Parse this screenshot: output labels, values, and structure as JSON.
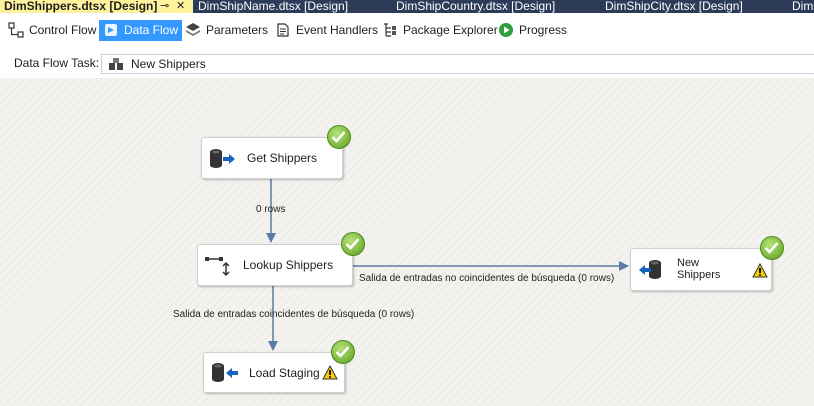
{
  "tabs": [
    {
      "label": "DimShippers.dtsx [Design]",
      "active": true,
      "pin": "⊸",
      "close": "✕"
    },
    {
      "label": "DimShipName.dtsx [Design]"
    },
    {
      "label": "DimShipCountry.dtsx [Design]"
    },
    {
      "label": "DimShipCity.dtsx [Design]"
    },
    {
      "label": "Dim"
    }
  ],
  "designer_tabs": [
    {
      "label": "Control Flow",
      "icon": "control-flow-icon"
    },
    {
      "label": "Data Flow",
      "icon": "data-flow-icon",
      "selected": true
    },
    {
      "label": "Parameters",
      "icon": "parameters-icon"
    },
    {
      "label": "Event Handlers",
      "icon": "event-handlers-icon"
    },
    {
      "label": "Package Explorer",
      "icon": "package-explorer-icon"
    },
    {
      "label": "Progress",
      "icon": "progress-icon"
    }
  ],
  "task": {
    "label": "Data Flow Task:",
    "value": "New Shippers"
  },
  "components": [
    {
      "name": "Get Shippers",
      "type": "source",
      "status": "success"
    },
    {
      "name": "Lookup Shippers",
      "type": "lookup",
      "status": "success"
    },
    {
      "name": "New Shippers",
      "type": "destination",
      "status": "success",
      "warning": true
    },
    {
      "name": "Load Staging",
      "type": "destination",
      "status": "success",
      "warning": true
    }
  ],
  "paths": [
    {
      "label": "0 rows"
    },
    {
      "label": "Salida de entradas no coincidentes de búsqueda (0 rows)"
    },
    {
      "label": "Salida de entradas coincidentes de búsqueda (0 rows)"
    }
  ],
  "colors": {
    "tab_strip": "#2b3b58",
    "active_tab": "#fff29d",
    "selected_designer_tab": "#3399ff",
    "wire": "#5b7ba8",
    "check": "#5a9e1e",
    "warning": "#f5d000"
  }
}
